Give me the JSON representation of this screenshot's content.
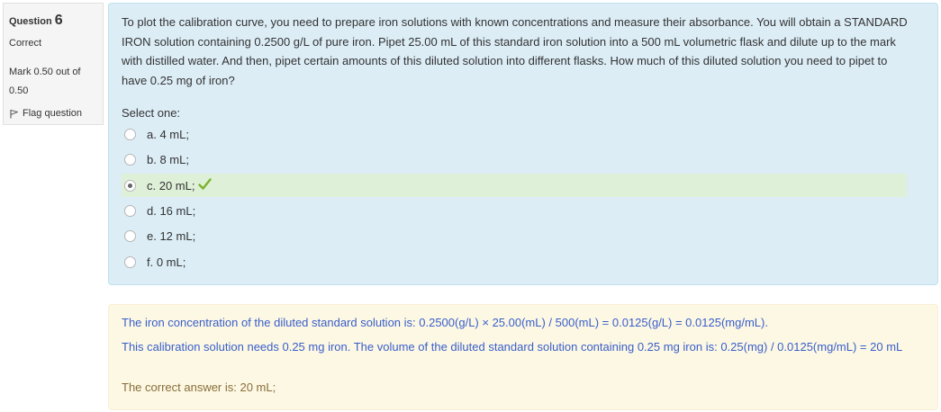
{
  "info": {
    "question_label": "Question",
    "question_number": "6",
    "state": "Correct",
    "grade_line1": "Mark 0.50 out of",
    "grade_line2": "0.50",
    "flag_label": "Flag question",
    "flag_icon": "flag-icon"
  },
  "question": {
    "text": "To plot the calibration curve, you need to prepare iron solutions with known concentrations and measure their absorbance. You will obtain a STANDARD IRON solution containing 0.2500 g/L of pure iron.  Pipet 25.00 mL of this standard iron solution into a 500 mL volumetric flask and dilute up to the mark with distilled water. And then, pipet certain amounts of this diluted solution into different flasks. How much of this diluted solution you need to pipet to have 0.25 mg of iron?",
    "prompt": "Select one:",
    "answers": [
      {
        "label": "a. 4 mL;",
        "selected": false,
        "correct": false
      },
      {
        "label": "b. 8 mL;",
        "selected": false,
        "correct": false
      },
      {
        "label": "c. 20 mL;",
        "selected": true,
        "correct": true
      },
      {
        "label": "d. 16 mL;",
        "selected": false,
        "correct": false
      },
      {
        "label": "e. 12 mL;",
        "selected": false,
        "correct": false
      },
      {
        "label": "f. 0 mL;",
        "selected": false,
        "correct": false
      }
    ]
  },
  "feedback": {
    "line1": "The iron concentration of the diluted standard solution is: 0.2500(g/L) × 25.00(mL) / 500(mL) = 0.0125(g/L) = 0.0125(mg/mL).",
    "line2": "This calibration solution needs 0.25 mg iron. The volume of the diluted standard solution containing 0.25 mg iron is: 0.25(mg) / 0.0125(mg/mL) = 20 mL",
    "right_answer": "The correct answer is: 20 mL;"
  },
  "colors": {
    "formulation_bg": "#dcedf6",
    "correct_row_bg": "#dff0d8",
    "check_green": "#7bb32e",
    "feedback_bg": "#fcf8e3",
    "feedback_text": "#3a5ecb",
    "right_answer_text": "#8a6d3b"
  }
}
